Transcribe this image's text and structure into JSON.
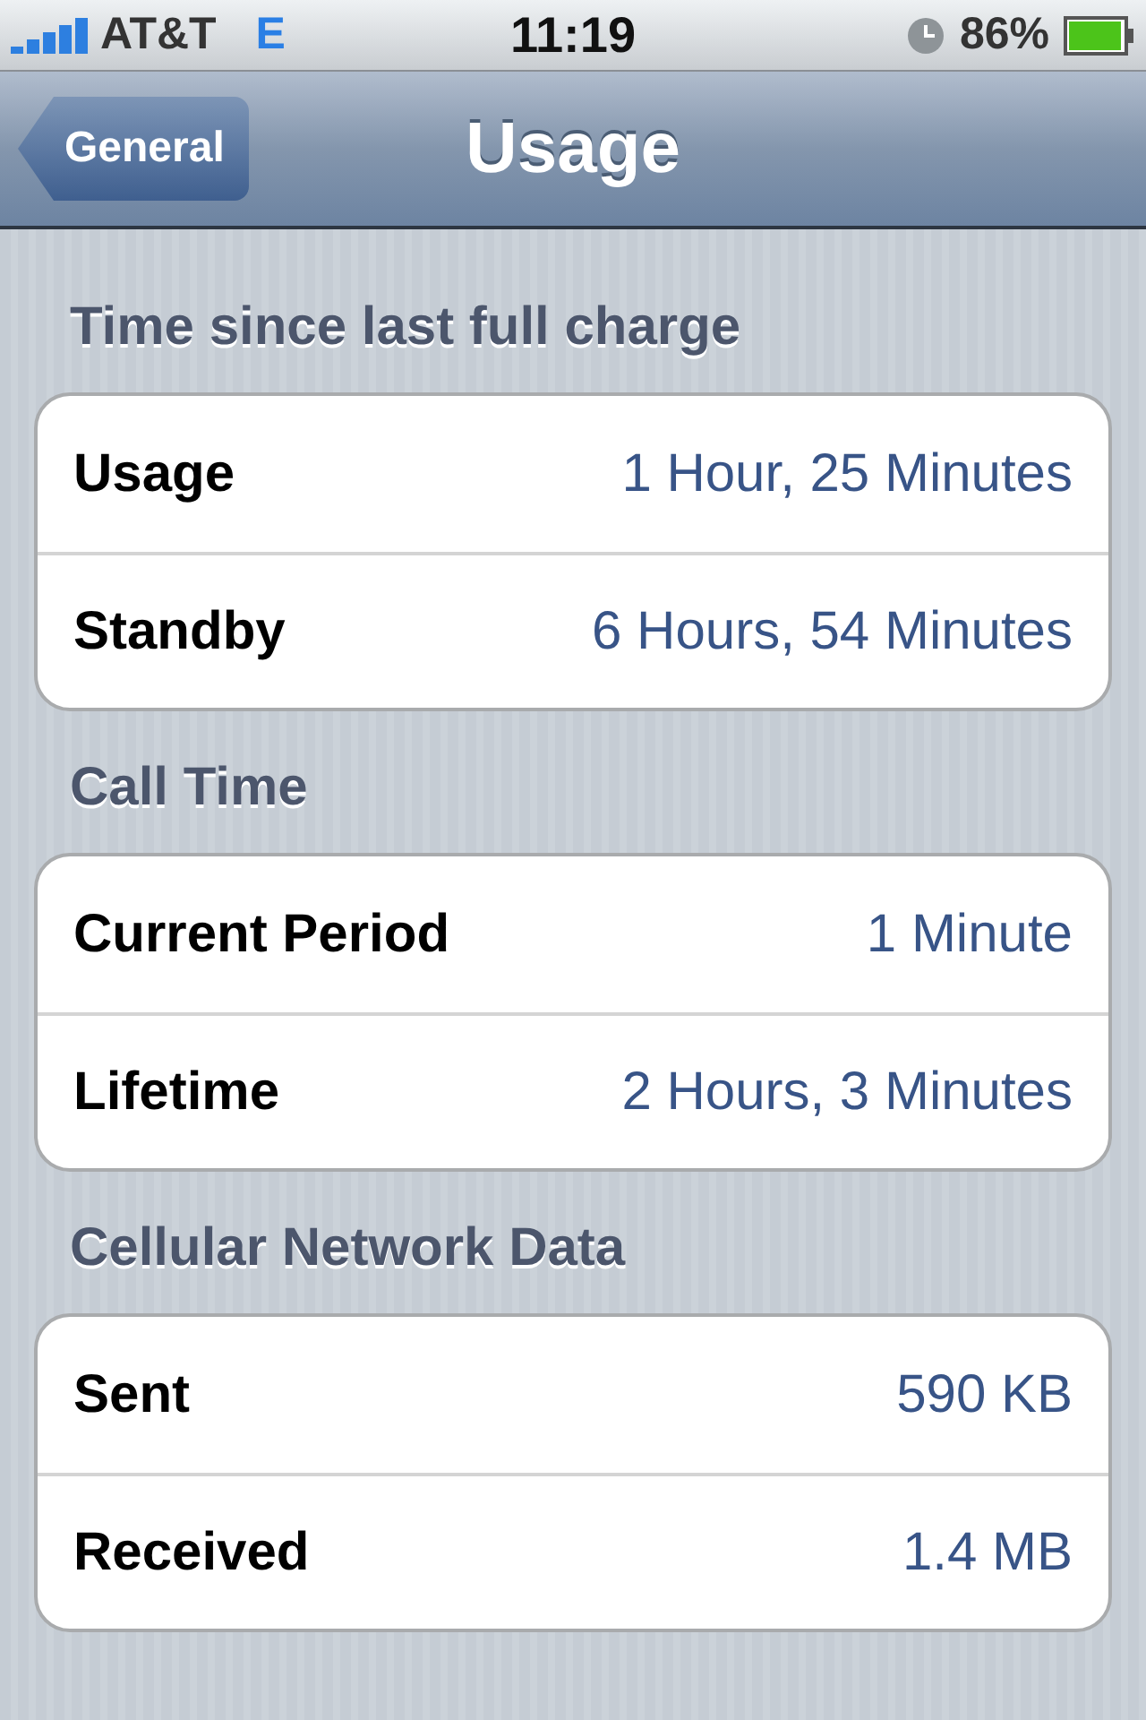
{
  "status_bar": {
    "carrier": "AT&T",
    "network": "E",
    "time": "11:19",
    "battery": "86%"
  },
  "nav_bar": {
    "back_button": "General",
    "title": "Usage"
  },
  "sections": [
    {
      "header": "Time since last full charge",
      "rows": [
        {
          "label": "Usage",
          "value": "1 Hour, 25 Minutes"
        },
        {
          "label": "Standby",
          "value": "6 Hours, 54 Minutes"
        }
      ]
    },
    {
      "header": "Call Time",
      "rows": [
        {
          "label": "Current Period",
          "value": "1 Minute"
        },
        {
          "label": "Lifetime",
          "value": "2 Hours, 3 Minutes"
        }
      ]
    },
    {
      "header": "Cellular Network Data",
      "rows": [
        {
          "label": "Sent",
          "value": "590 KB"
        },
        {
          "label": "Received",
          "value": "1.4 MB"
        }
      ]
    }
  ]
}
